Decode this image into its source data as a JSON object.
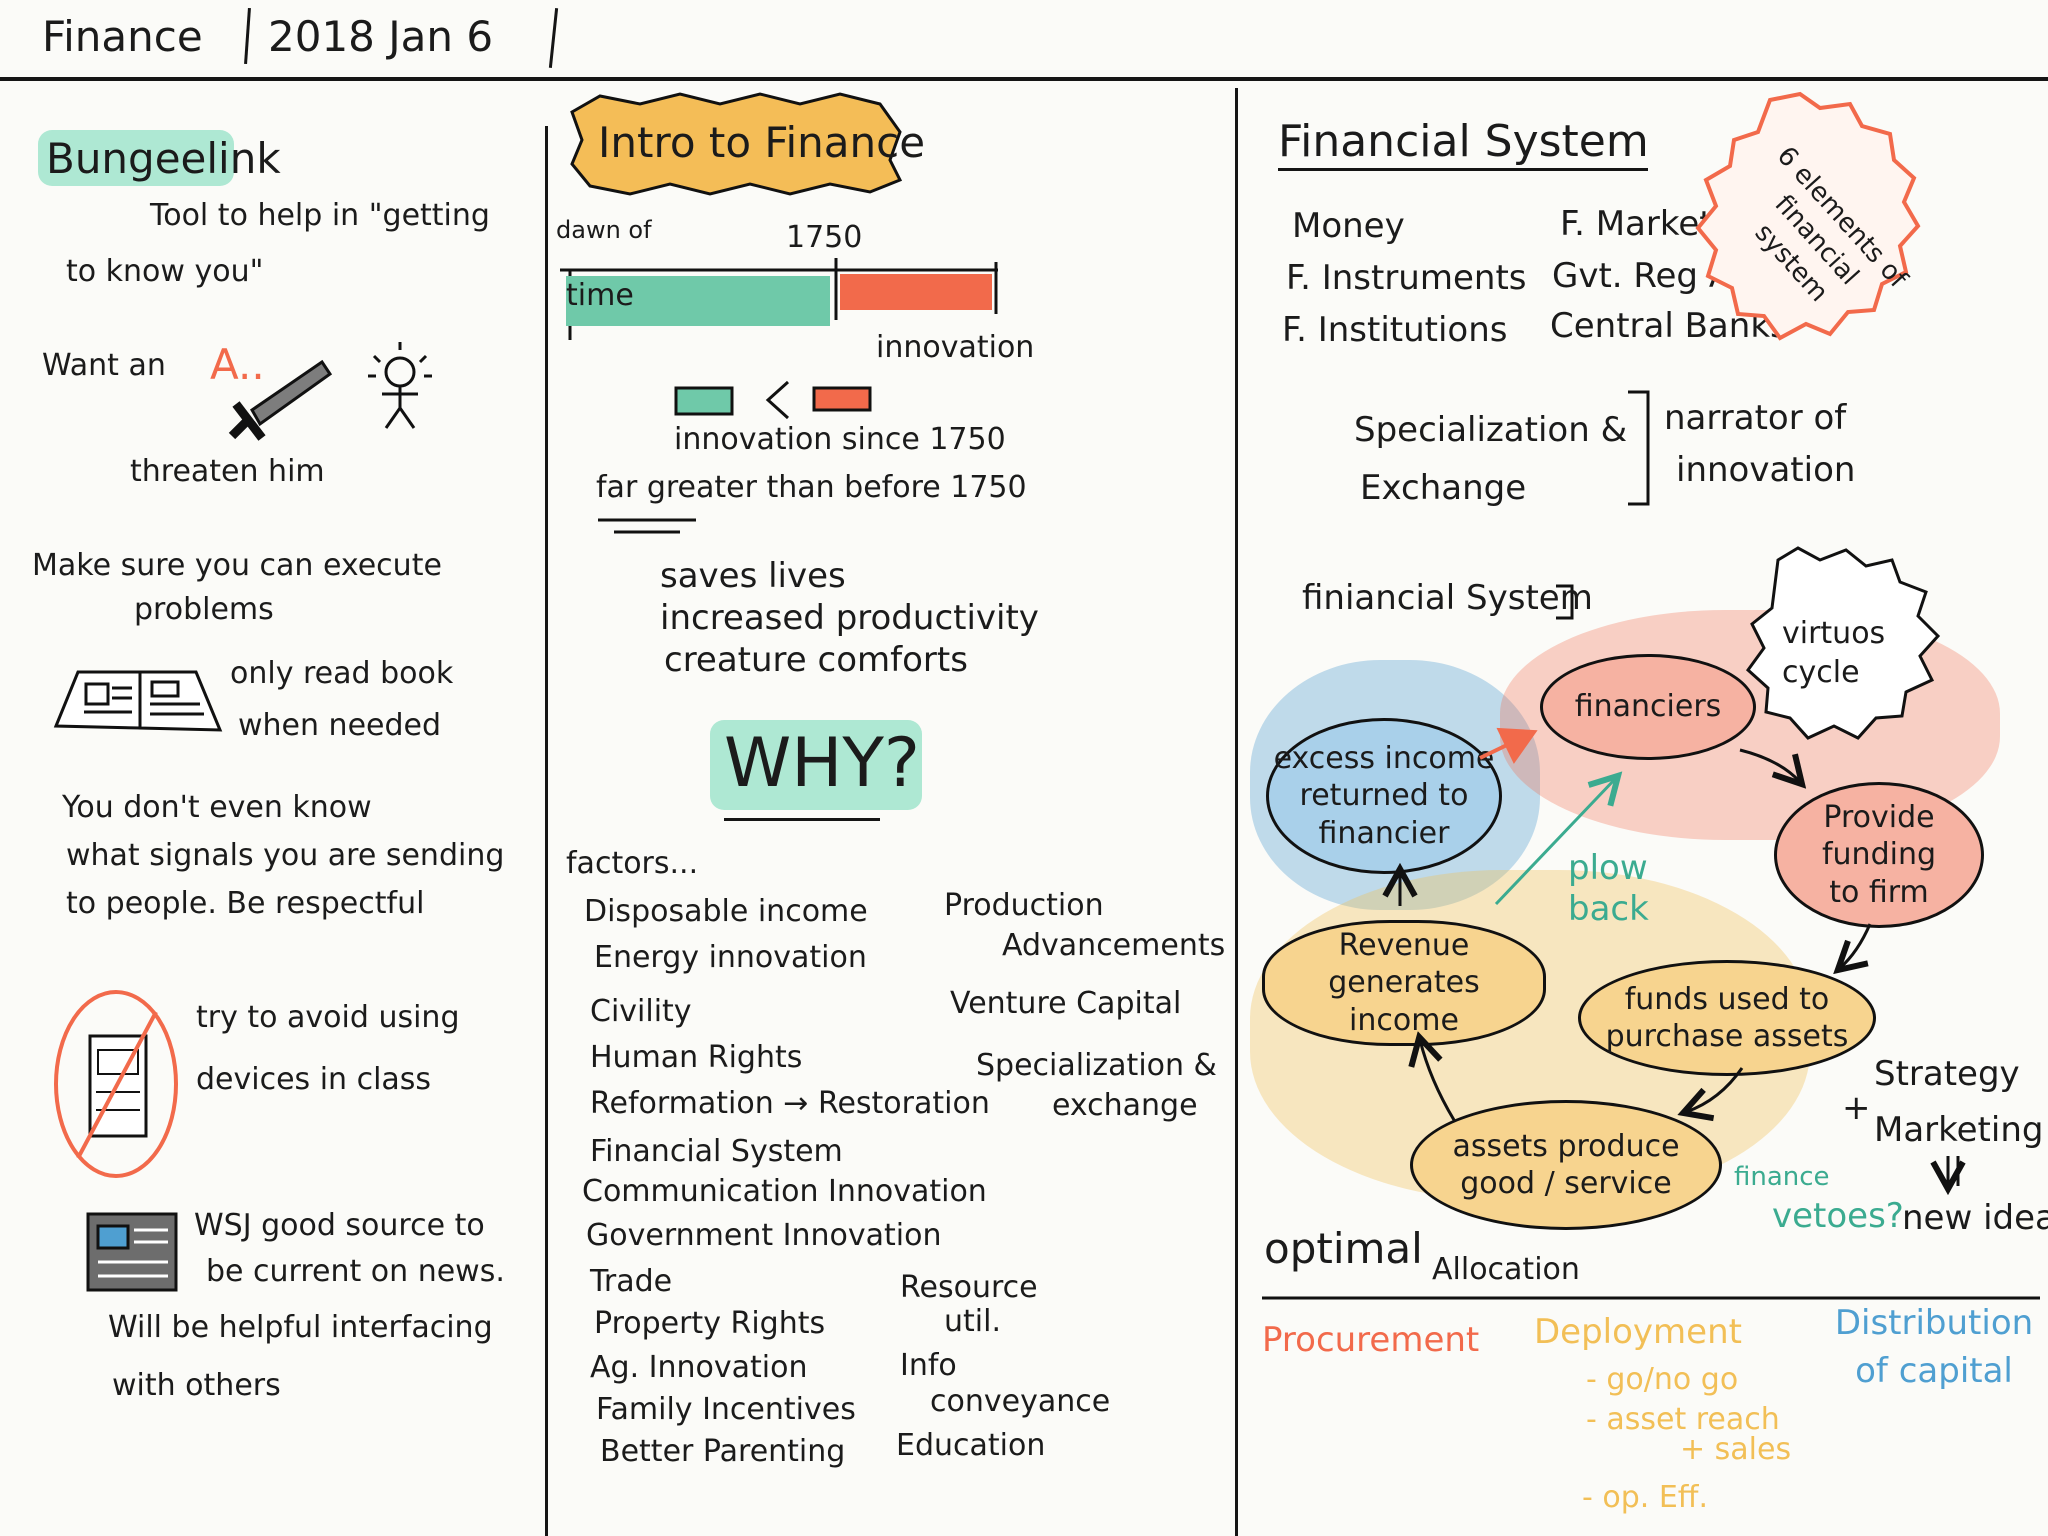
{
  "header": {
    "subject": "Finance",
    "date": "2018 Jan 6"
  },
  "col1": {
    "title": "Bungeelink",
    "tool_line1": "Tool to help in \"getting",
    "tool_line2": "to know you\"",
    "want": "Want an",
    "grade": "A..",
    "threaten": "threaten him",
    "execute_line1": "Make sure you can execute",
    "execute_line2": "problems",
    "read_line1": "only read book",
    "read_line2": "when needed",
    "signals_line1": "You don't even know",
    "signals_line2": "what signals you are sending",
    "signals_line3": "to people. Be respectful",
    "devices_line1": "try to avoid using",
    "devices_line2": "devices in class",
    "wsj_line1": "WSJ good source to",
    "wsj_line2": "be current on news.",
    "wsj_line3": "Will be helpful interfacing",
    "wsj_line4": "with others"
  },
  "col2": {
    "title": "Intro to Finance",
    "dawn": "dawn of",
    "year": "1750",
    "time": "time",
    "innovation": "innovation",
    "since": "innovation since 1750",
    "far": "far greater than before 1750",
    "benefits": [
      "saves lives",
      "increased productivity",
      "creature comforts"
    ],
    "why": "WHY?",
    "factors_title": "factors...",
    "factors_left": [
      "Disposable income",
      "Energy innovation",
      "Civility",
      "Human Rights",
      "Reformation → Restoration",
      "Financial System",
      "Communication Innovation",
      "Government Innovation",
      "Trade",
      "Property Rights",
      "Ag. Innovation",
      "Family Incentives",
      "Better Parenting"
    ],
    "factors_right_top": [
      "Production",
      "Advancements",
      "Venture Capital",
      "Specialization &",
      "exchange"
    ],
    "factors_right_bottom": [
      "Resource",
      "util.",
      "Info",
      "conveyance",
      "Education"
    ]
  },
  "col3": {
    "title": "Financial System",
    "elements_left": [
      "Money",
      "F. Instruments",
      "F. Institutions"
    ],
    "elements_right": [
      "F. Markets",
      "Gvt. Reg Agencies",
      "Central Banks"
    ],
    "badge": "6 elements of financial system",
    "spec_line1": "Specialization &",
    "spec_line2": "Exchange",
    "narrator_line1": "narrator of",
    "narrator_line2": "innovation",
    "fin_sys": "finiancial System",
    "virtuous": "virtuos cycle",
    "nodes": {
      "financiers": "financiers",
      "provide": "Provide\nfunding\nto firm",
      "funds": "funds used to\npurchase assets",
      "assets": "assets produce\ngood / service",
      "revenue": "Revenue generates\nincome",
      "excess": "excess income\nreturned to\nfinancier"
    },
    "plow": "plow back",
    "strategy": "Strategy",
    "marketing": "Marketing",
    "plus": "+",
    "new_ideas": "new ideas",
    "finance": "finance",
    "vetoes": "vetoes?",
    "optimal": "optimal",
    "allocation": "Allocation",
    "procurement": "Procurement",
    "deployment": "Deployment",
    "deployment_items": [
      "- go/no go",
      "- asset reach",
      "+ sales",
      "- op. Eff."
    ],
    "distribution": "Distribution of capital"
  },
  "colors": {
    "ink": "#1b1b1b",
    "teal": "#6fc9a9",
    "orange": "#f26a4b",
    "yellow": "#f2bf56",
    "blue": "#4f9fd1",
    "green": "#3bab90"
  }
}
